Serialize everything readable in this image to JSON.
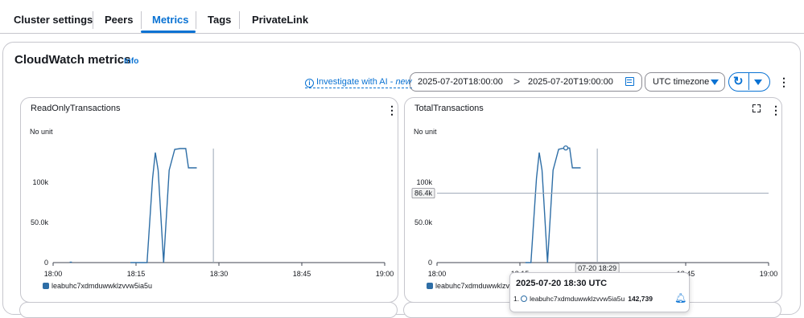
{
  "tabs": [
    {
      "label": "Cluster settings",
      "active": false
    },
    {
      "label": "Peers",
      "active": false
    },
    {
      "label": "Metrics",
      "active": true
    },
    {
      "label": "Tags",
      "active": false
    },
    {
      "label": "PrivateLink",
      "active": false
    }
  ],
  "panel": {
    "title": "CloudWatch metrics",
    "info": "Info"
  },
  "toolbar": {
    "investigate_label": "Investigate with AI - ",
    "investigate_new": "new",
    "range_start": "2025-07-20T18:00:00",
    "range_arrow": ">",
    "range_end": "2025-07-20T19:00:00",
    "timezone": "UTC timezone",
    "refresh_icon": "refresh-icon",
    "colors": {
      "accent": "#0972d3",
      "series": "#2e6ea6"
    }
  },
  "widgets": [
    {
      "title": "ReadOnlyTransactions",
      "unit": "No unit",
      "legend": "leabuhc7xdmduwwklzvvw5ia5u",
      "menu_glyph": "⋮"
    },
    {
      "title": "TotalTransactions",
      "unit": "No unit",
      "legend": "leabuhc7xdmduwwklzvvw5ia5u",
      "menu_glyph": "⋮",
      "crosshair_value": "86.4k",
      "crosshair_time": "07-20 18:29"
    }
  ],
  "chart_data": [
    {
      "type": "line",
      "title": "ReadOnlyTransactions",
      "ylabel": "No unit",
      "x_ticks": [
        "18:00",
        "18:15",
        "18:30",
        "18:45",
        "19:00"
      ],
      "y_ticks": [
        "0",
        "50.0k",
        "100k"
      ],
      "ylim": [
        0,
        150000
      ],
      "xlim": [
        0,
        60
      ],
      "series": [
        {
          "name": "leabuhc7xdmduwwklzvvw5ia5u",
          "x": [
            14,
            14.5,
            16,
            17,
            18,
            18.5,
            19,
            20,
            21,
            22,
            23,
            24,
            24.5,
            25,
            26
          ],
          "y": [
            0,
            0,
            0,
            0,
            105000,
            137000,
            115000,
            0,
            115000,
            141000,
            142000,
            142000,
            118000,
            118000,
            118000
          ]
        }
      ]
    },
    {
      "type": "line",
      "title": "TotalTransactions",
      "ylabel": "No unit",
      "x_ticks": [
        "18:00",
        "18:15",
        "18:30",
        "18:45",
        "19:00"
      ],
      "y_ticks": [
        "0",
        "50.0k",
        "100k"
      ],
      "ylim": [
        0,
        150000
      ],
      "xlim": [
        0,
        60
      ],
      "series": [
        {
          "name": "leabuhc7xdmduwwklzvvw5ia5u",
          "x": [
            16,
            17,
            18,
            18.5,
            19,
            20,
            21,
            22,
            23,
            24,
            24.5,
            25,
            26
          ],
          "y": [
            0,
            0,
            105000,
            137000,
            115000,
            0,
            115000,
            141000,
            142739,
            142739,
            118000,
            118000,
            118000
          ]
        }
      ]
    }
  ],
  "tooltip": {
    "title": "2025-07-20 18:30 UTC",
    "index": "1.",
    "series": "leabuhc7xdmduwwklzvvw5ia5u",
    "value": "142,739"
  }
}
